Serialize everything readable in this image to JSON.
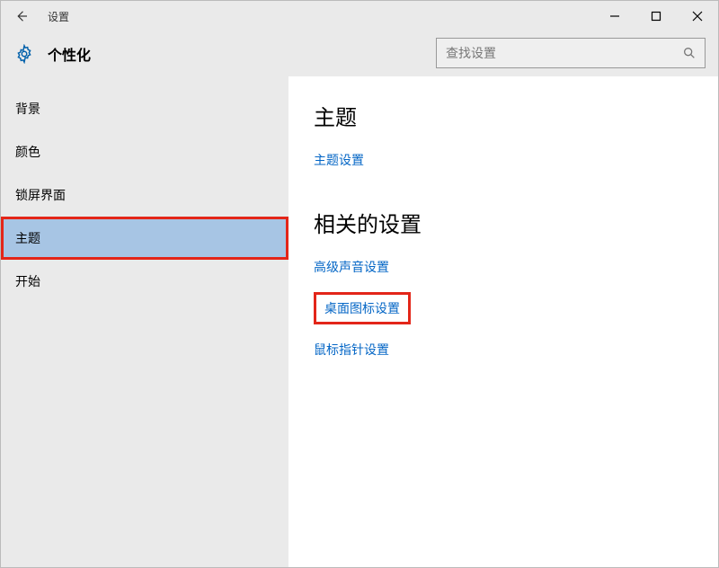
{
  "window": {
    "title": "设置"
  },
  "header": {
    "section": "个性化"
  },
  "search": {
    "placeholder": "查找设置"
  },
  "sidebar": {
    "items": [
      {
        "label": "背景"
      },
      {
        "label": "颜色"
      },
      {
        "label": "锁屏界面"
      },
      {
        "label": "主题",
        "selected": true,
        "highlighted": true
      },
      {
        "label": "开始"
      }
    ]
  },
  "content": {
    "heading": "主题",
    "theme_settings_link": "主题设置",
    "related_heading": "相关的设置",
    "links": [
      {
        "label": "高级声音设置",
        "highlighted": false
      },
      {
        "label": "桌面图标设置",
        "highlighted": true
      },
      {
        "label": "鼠标指针设置",
        "highlighted": false
      }
    ]
  }
}
